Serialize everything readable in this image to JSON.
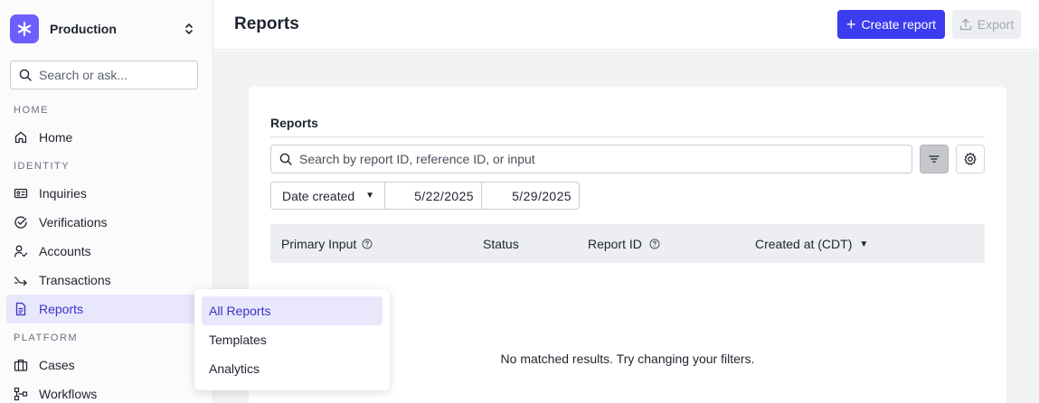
{
  "workspace": {
    "name": "Production",
    "logo_icon": "asterisk-icon"
  },
  "sidebar": {
    "search_placeholder": "Search or ask...",
    "sections": {
      "home": "HOME",
      "identity": "IDENTITY",
      "platform": "PLATFORM"
    },
    "items": [
      {
        "label": "Home",
        "icon": "house-icon"
      },
      {
        "label": "Inquiries",
        "icon": "id-card-icon"
      },
      {
        "label": "Verifications",
        "icon": "check-circle-icon"
      },
      {
        "label": "Accounts",
        "icon": "user-check-icon"
      },
      {
        "label": "Transactions",
        "icon": "transfer-arrow-icon"
      },
      {
        "label": "Reports",
        "icon": "document-icon",
        "active": true
      },
      {
        "label": "Cases",
        "icon": "briefcase-icon"
      },
      {
        "label": "Workflows",
        "icon": "workflow-icon"
      }
    ]
  },
  "header": {
    "title": "Reports",
    "create_label": "Create report",
    "export_label": "Export"
  },
  "reports": {
    "card_title": "Reports",
    "search_placeholder": "Search by report ID, reference ID, or input",
    "date_filter": {
      "field": "Date created",
      "from": "5/22/2025",
      "to": "5/29/2025"
    },
    "columns": [
      "Primary Input",
      "Status",
      "Report ID",
      "Created at (CDT)"
    ],
    "empty_message": "No matched results. Try changing your filters."
  },
  "flyout": {
    "items": [
      {
        "label": "All Reports",
        "active": true
      },
      {
        "label": "Templates"
      },
      {
        "label": "Analytics"
      }
    ]
  },
  "colors": {
    "accent": "#3b3bf0",
    "logo": "#6d5dfc",
    "active_bg": "#e8e7fb"
  }
}
